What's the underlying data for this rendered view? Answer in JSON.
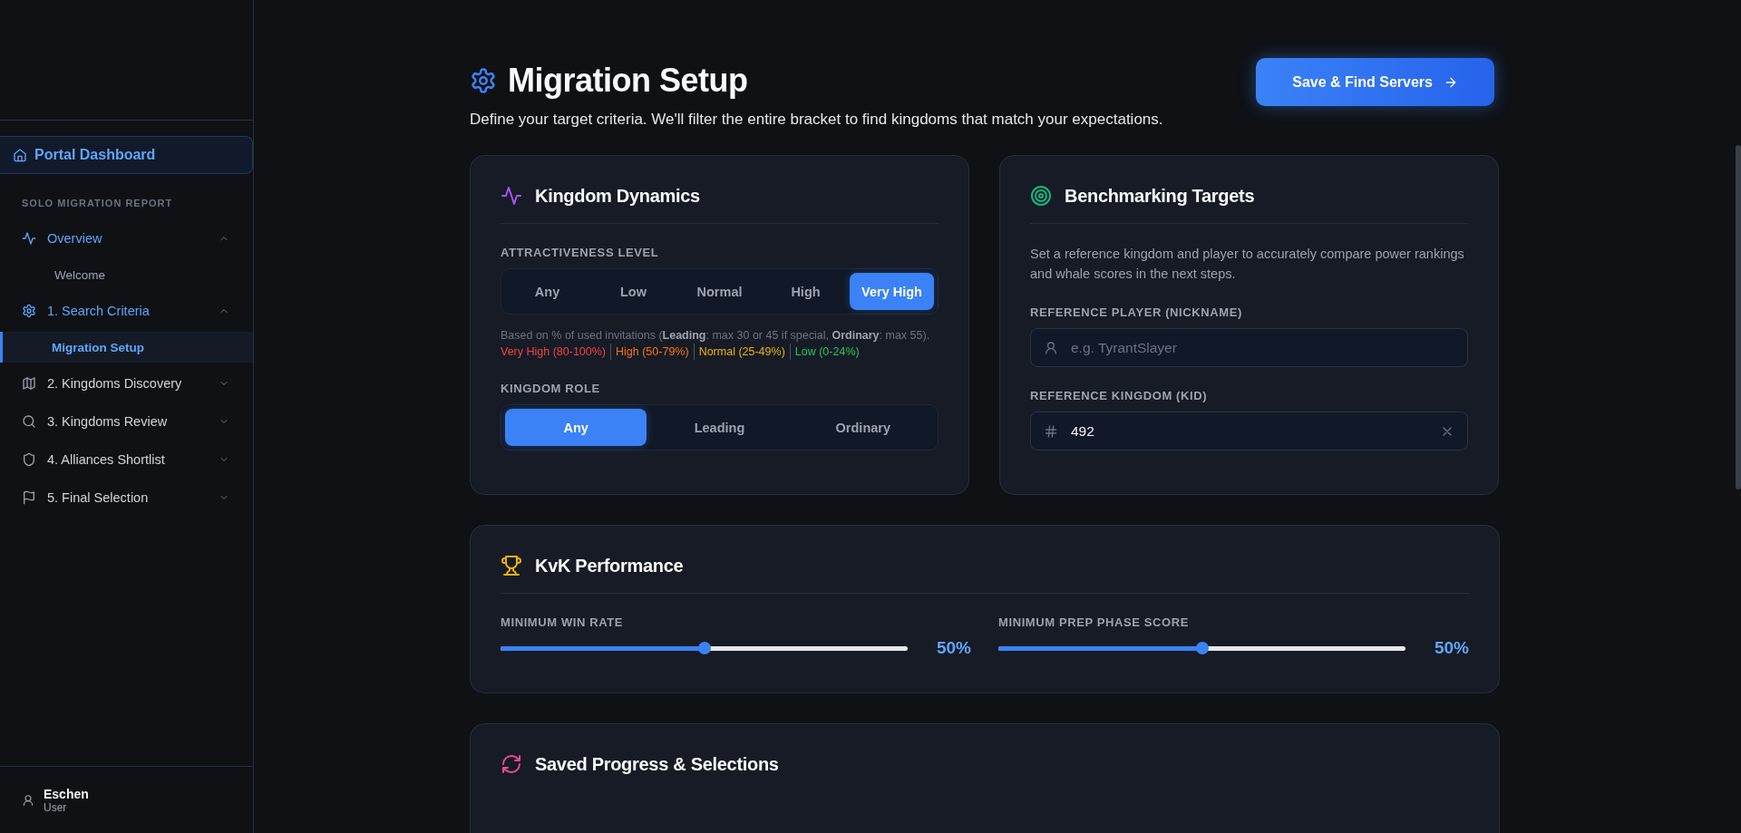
{
  "sidebar": {
    "dashboard": {
      "label": "Portal Dashboard"
    },
    "section_label": "SOLO MIGRATION REPORT",
    "items": [
      {
        "label": "Overview",
        "expanded": true,
        "children": [
          {
            "label": "Welcome",
            "selected": false
          }
        ]
      },
      {
        "label": "1. Search Criteria",
        "expanded": true,
        "children": [
          {
            "label": "Migration Setup",
            "selected": true
          }
        ]
      },
      {
        "label": "2. Kingdoms Discovery",
        "expanded": false
      },
      {
        "label": "3. Kingdoms Review",
        "expanded": false
      },
      {
        "label": "4. Alliances Shortlist",
        "expanded": false
      },
      {
        "label": "5. Final Selection",
        "expanded": false
      }
    ],
    "user": {
      "name": "Eschen",
      "role": "User"
    }
  },
  "header": {
    "title": "Migration Setup",
    "subtitle": "Define your target criteria. We'll filter the entire bracket to find kingdoms that match your expectations.",
    "save_button": "Save & Find Servers"
  },
  "dynamics": {
    "title": "Kingdom Dynamics",
    "attractiveness": {
      "label": "ATTRACTIVENESS LEVEL",
      "options": [
        {
          "label": "Any",
          "selected": false
        },
        {
          "label": "Low",
          "selected": false
        },
        {
          "label": "Normal",
          "selected": false
        },
        {
          "label": "High",
          "selected": false
        },
        {
          "label": "Very High",
          "selected": true
        }
      ]
    },
    "note": "Based on % of used invitations (**Leading**: max 30 or 45 if special, **Ordinary**: max 55).",
    "legend": [
      {
        "text": "Very High (80-100%)",
        "color": "#ef4444"
      },
      {
        "text": "High (50-79%)",
        "color": "#f97316"
      },
      {
        "text": "Normal (25-49%)",
        "color": "#eab308"
      },
      {
        "text": "Low (0-24%)",
        "color": "#22c55e"
      }
    ],
    "role": {
      "label": "KINGDOM ROLE",
      "options": [
        {
          "label": "Any",
          "selected": true
        },
        {
          "label": "Leading",
          "selected": false
        },
        {
          "label": "Ordinary",
          "selected": false
        }
      ]
    }
  },
  "benchmark": {
    "title": "Benchmarking Targets",
    "description": "Set a reference kingdom and player to accurately compare power rankings and whale scores in the next steps.",
    "player_field": {
      "label": "REFERENCE PLAYER (NICKNAME)",
      "placeholder": "e.g. TyrantSlayer"
    },
    "kingdom_field": {
      "label": "REFERENCE KINGDOM (KID)",
      "value": "492"
    }
  },
  "kvk": {
    "title": "KvK Performance",
    "sliders": [
      {
        "label": "MINIMUM WIN RATE",
        "level": 0.5,
        "reading": "50%"
      },
      {
        "label": "MINIMUM PREP PHASE SCORE",
        "level": 0.5,
        "reading": "50%"
      }
    ]
  },
  "saved": {
    "title": "Saved Progress & Selections"
  }
}
